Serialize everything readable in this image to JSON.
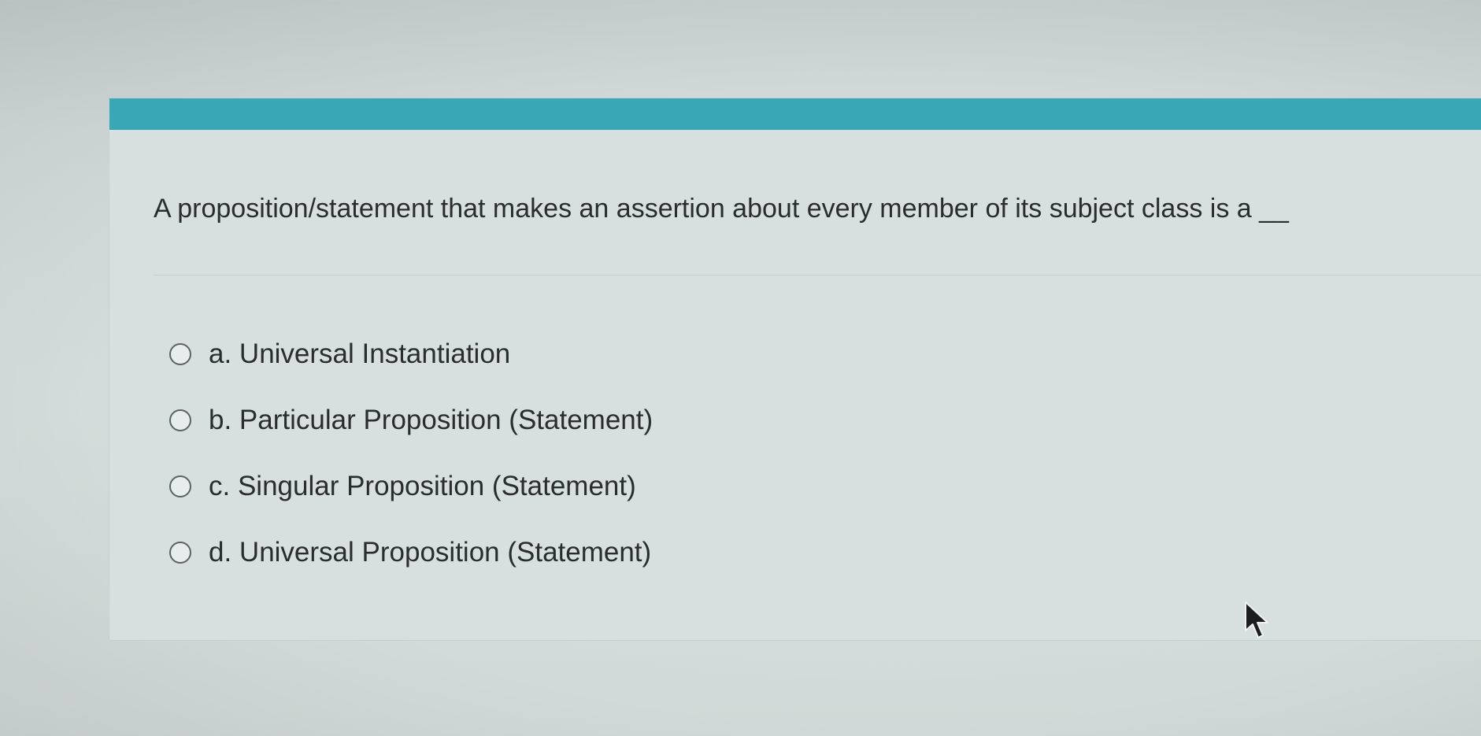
{
  "question": {
    "text": "A proposition/statement that makes an assertion about every member of its subject class is a __"
  },
  "options": [
    {
      "label": "a. Universal Instantiation",
      "selected": false
    },
    {
      "label": "b. Particular Proposition (Statement)",
      "selected": false
    },
    {
      "label": "c. Singular Proposition (Statement)",
      "selected": false
    },
    {
      "label": "d. Universal Proposition (Statement)",
      "selected": false
    }
  ],
  "colors": {
    "accent_bar": "#3aa7b6",
    "background": "#d7dfde",
    "text": "#2a2d2e"
  },
  "icons": {
    "cursor": "mouse-pointer-icon",
    "radio": "radio-button-icon"
  }
}
